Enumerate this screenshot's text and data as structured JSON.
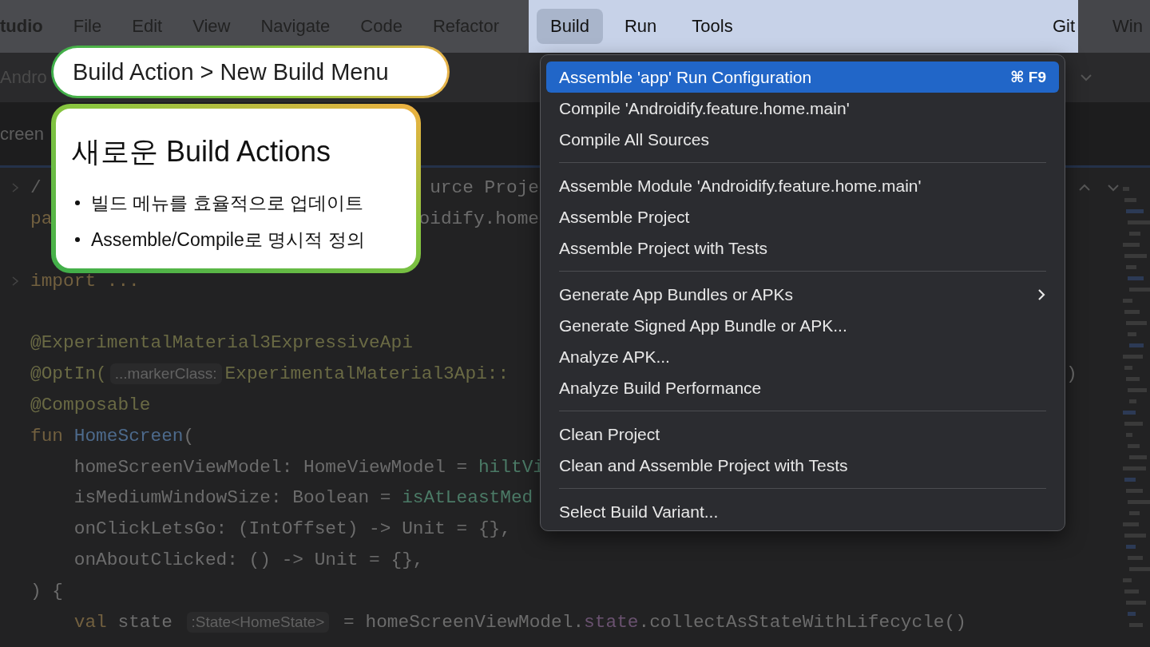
{
  "menu_bar": {
    "dimmed_left": [
      {
        "label": "tudio",
        "kind": "app"
      },
      {
        "label": "File",
        "kind": "menu"
      },
      {
        "label": "Edit",
        "kind": "menu"
      },
      {
        "label": "View",
        "kind": "menu"
      },
      {
        "label": "Navigate",
        "kind": "menu"
      },
      {
        "label": "Code",
        "kind": "menu"
      },
      {
        "label": "Refactor",
        "kind": "menu"
      }
    ],
    "focused": [
      {
        "label": "Build",
        "selected": true
      },
      {
        "label": "Run",
        "selected": false
      },
      {
        "label": "Tools",
        "selected": false
      },
      {
        "label": "Git",
        "selected": false
      }
    ],
    "dimmed_right": [
      {
        "label": "Win"
      }
    ]
  },
  "toolbar": {
    "project": "Andro"
  },
  "editor_tab": {
    "label": "creen"
  },
  "code_lines": [
    {
      "kind": "code",
      "fold": true,
      "segments": [
        {
          "kind": "comment",
          "text": "/"
        }
      ],
      "tail": "urce Proje"
    },
    {
      "kind": "code",
      "fold": false,
      "segments": [
        {
          "kind": "keyword",
          "text": "pa"
        }
      ],
      "tail": "oidify.home"
    },
    {
      "kind": "blank"
    },
    {
      "kind": "code",
      "fold": true,
      "segments": [
        {
          "kind": "keyword",
          "text": "import ..."
        }
      ]
    },
    {
      "kind": "blank"
    },
    {
      "kind": "code",
      "fold": false,
      "segments": [
        {
          "kind": "annotation",
          "text": "@ExperimentalMaterial3ExpressiveApi"
        }
      ]
    },
    {
      "kind": "code",
      "fold": false,
      "segments": [
        {
          "kind": "annotation",
          "text": "@OptIn("
        },
        {
          "kind": "hint",
          "text": "...markerClass:"
        },
        {
          "kind": "annotation",
          "text": "ExperimentalMaterial3Api::"
        }
      ],
      "after": ")"
    },
    {
      "kind": "code",
      "fold": false,
      "segments": [
        {
          "kind": "annotation",
          "text": "@Composable"
        }
      ]
    },
    {
      "kind": "code",
      "fold": false,
      "segments": [
        {
          "kind": "keyword",
          "text": "fun "
        },
        {
          "kind": "function",
          "text": "HomeScreen"
        },
        {
          "kind": "plain",
          "text": "("
        }
      ]
    },
    {
      "kind": "code",
      "fold": false,
      "segments": [
        {
          "kind": "plain",
          "text": "    homeScreenViewModel: HomeViewModel = "
        },
        {
          "kind": "call",
          "text": "hiltVi"
        }
      ]
    },
    {
      "kind": "code",
      "fold": false,
      "segments": [
        {
          "kind": "plain",
          "text": "    isMediumWindowSize: Boolean = "
        },
        {
          "kind": "call",
          "text": "isAtLeastMed"
        }
      ]
    },
    {
      "kind": "code",
      "fold": false,
      "segments": [
        {
          "kind": "plain",
          "text": "    onClickLetsGo: (IntOffset) -> Unit = {},"
        }
      ]
    },
    {
      "kind": "code",
      "fold": false,
      "segments": [
        {
          "kind": "plain",
          "text": "    onAboutClicked: () -> Unit = {},"
        }
      ]
    },
    {
      "kind": "code",
      "fold": false,
      "segments": [
        {
          "kind": "plain",
          "text": ") {"
        }
      ]
    },
    {
      "kind": "code",
      "fold": false,
      "segments": [
        {
          "kind": "keyword",
          "text": "    val "
        },
        {
          "kind": "plain",
          "text": "state "
        },
        {
          "kind": "hint",
          "text": ":State<HomeState>"
        },
        {
          "kind": "plain",
          "text": " = homeScreenViewModel."
        },
        {
          "kind": "property",
          "text": "state"
        },
        {
          "kind": "plain",
          "text": ".collectAsStateWithLifecycle()"
        }
      ]
    }
  ],
  "build_menu": {
    "items": [
      {
        "kind": "item",
        "label": "Assemble 'app' Run Configuration",
        "shortcut": "⌘ F9",
        "selected": true,
        "submenu": false
      },
      {
        "kind": "item",
        "label": "Compile 'Androidify.feature.home.main'",
        "selected": false,
        "submenu": false
      },
      {
        "kind": "item",
        "label": "Compile All Sources",
        "selected": false,
        "submenu": false
      },
      {
        "kind": "separator"
      },
      {
        "kind": "item",
        "label": "Assemble Module 'Androidify.feature.home.main'",
        "selected": false,
        "submenu": false
      },
      {
        "kind": "item",
        "label": "Assemble Project",
        "selected": false,
        "submenu": false
      },
      {
        "kind": "item",
        "label": "Assemble Project with Tests",
        "selected": false,
        "submenu": false
      },
      {
        "kind": "separator"
      },
      {
        "kind": "item",
        "label": "Generate App Bundles or APKs",
        "selected": false,
        "submenu": true
      },
      {
        "kind": "item",
        "label": "Generate Signed App Bundle or APK...",
        "selected": false,
        "submenu": false
      },
      {
        "kind": "item",
        "label": "Analyze APK...",
        "selected": false,
        "submenu": false
      },
      {
        "kind": "item",
        "label": "Analyze Build Performance",
        "selected": false,
        "submenu": false
      },
      {
        "kind": "separator"
      },
      {
        "kind": "item",
        "label": "Clean Project",
        "selected": false,
        "submenu": false
      },
      {
        "kind": "item",
        "label": "Clean and Assemble Project with Tests",
        "selected": false,
        "submenu": false
      },
      {
        "kind": "separator"
      },
      {
        "kind": "item",
        "label": "Select Build Variant...",
        "selected": false,
        "submenu": false
      }
    ]
  },
  "callouts": {
    "breadcrumb": "Build Action > New Build Menu",
    "title": "새로운 Build Actions",
    "bullets": [
      "빌드 메뉴를 효율적으로 업데이트",
      "Assemble/Compile로 명시적 정의"
    ]
  }
}
